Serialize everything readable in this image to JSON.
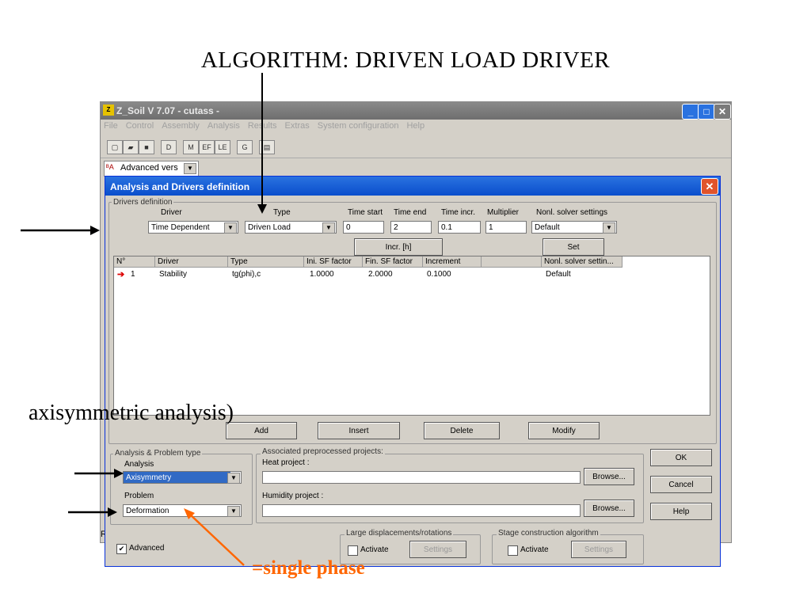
{
  "slide": {
    "title": "ALGORITHM: DRIVEN LOAD DRIVER",
    "annotation_axisym": "axisymmetric analysis)",
    "annotation_single": "=single phase"
  },
  "app": {
    "title": "Z_Soil V 7.07 - cutass -",
    "icon": "zsoil-app-icon",
    "menu": [
      "File",
      "Control",
      "Assembly",
      "Analysis",
      "Results",
      "Extras",
      "System configuration",
      "Help"
    ],
    "toolbar_icons": [
      "new-file-icon",
      "open-folder-icon",
      "save-icon",
      "d-icon",
      "m-icon",
      "ef-icon",
      "le-icon",
      "tab-icon",
      "img-icon"
    ],
    "advanced_vers": "Advanced vers",
    "status_left": "R"
  },
  "dialog": {
    "title": "Analysis and Drivers definition",
    "drivers_group": "Drivers definition",
    "col_driver": "Driver",
    "col_type": "Type",
    "col_time_start": "Time start",
    "col_time_end": "Time end",
    "col_time_incr": "Time incr.",
    "col_multiplier": "Multiplier",
    "col_nonl": "Nonl. solver settings",
    "driver_value": "Time Dependent",
    "type_value": "Driven Load",
    "time_start": "0",
    "time_end": "2",
    "time_incr": "0.1",
    "multiplier": "1",
    "nonl_value": "Default",
    "incr_button": "Incr. [h]",
    "set_button": "Set",
    "table": {
      "headers": [
        "N°",
        "Driver",
        "Type",
        "Ini. SF factor",
        "Fin. SF factor",
        "Increment",
        "",
        "Nonl. solver settin..."
      ],
      "rows": [
        {
          "n": "1",
          "driver": "Stability",
          "type": "tg(phi),c",
          "ini": "1.0000",
          "fin": "2.0000",
          "increment": "0.1000",
          "blank": "",
          "nonl": "Default"
        }
      ]
    },
    "buttons": {
      "add": "Add",
      "insert": "Insert",
      "delete": "Delete",
      "modify": "Modify"
    },
    "analysis_group": "Analysis & Problem type",
    "analysis_label": "Analysis",
    "analysis_value": "Axisymmetry",
    "problem_label": "Problem",
    "problem_value": "Deformation",
    "assoc_group": "Associated preprocessed projects:",
    "heat_label": "Heat project :",
    "humidity_label": "Humidity project :",
    "browse": "Browse...",
    "ok": "OK",
    "cancel": "Cancel",
    "help": "Help",
    "large_group": "Large displacements/rotations",
    "stage_group": "Stage construction algorithm",
    "activate": "Activate",
    "settings": "Settings",
    "advanced_check": "Advanced",
    "advanced_checked": "✔"
  },
  "colors": {
    "annotation_orange": "#ff6600",
    "arrow": "#000000",
    "dialog_title": "#0a4ecc"
  }
}
